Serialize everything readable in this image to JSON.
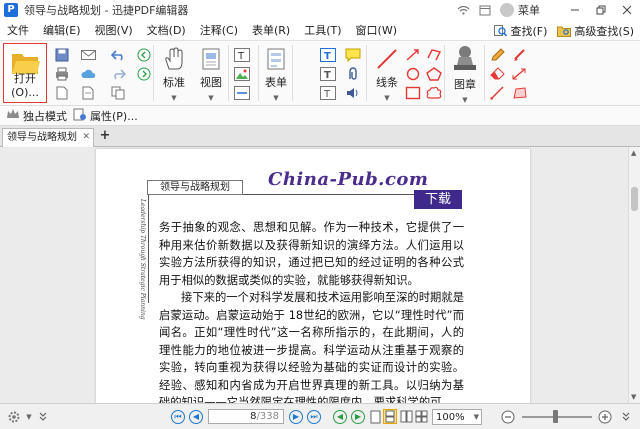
{
  "app": {
    "title": "领导与战略规划 - 迅捷PDF编辑器",
    "logo_letter": "P",
    "user_name": "菜单",
    "colors": {
      "accent": "#1e6fd9",
      "highlight_border": "#e53935",
      "brand_purple": "#4a2c8f"
    }
  },
  "menu": {
    "items": [
      "文件",
      "编辑(E)",
      "视图(V)",
      "文档(D)",
      "注释(C)",
      "表单(R)",
      "工具(T)",
      "窗口(W)"
    ],
    "search_label": "查找(F)",
    "advanced_search_label": "高级查找(S)"
  },
  "ribbon": {
    "open_label": "打开(O)...",
    "standard_label": "标准",
    "view_label": "视图",
    "form_label": "表单",
    "line_label": "线条",
    "stamp_label": "图章"
  },
  "modebar": {
    "exclusive_mode_label": "独占模式",
    "properties_label": "属性(P)..."
  },
  "tabs": [
    {
      "label": "领导与战略规划"
    }
  ],
  "document": {
    "header_box": "领导与战略规划",
    "brand": "China-Pub.com",
    "download_badge": "下载",
    "vertical_text": "Leadership Through Strategic Planning",
    "paragraphs": [
      "务于抽象的观念、思想和见解。作为一种技术，它提供了一种用来估价新数据以及获得新知识的演绎方法。人们运用以实验方法所获得的知识，通过把已知的经过证明的各种公式用于相似的数据或类似的实验，就能够获得新知识。",
      "接下来的一个对科学发展和技术运用影响至深的时期就是启蒙运动。启蒙运动始于 18世纪的欧洲，它以“理性时代”而闻名。正如“理性时代”这一名称所指示的，在此期间，人的理性能力的地位被进一步提高。科学运动从注重基于观察的实验，转向重视为获得以经验为基础的实证而设计的实验。经验、感知和内省成为开启世界真理的新工具。以归纳为基础的知识——它当然限定在理性的限度内，要求科学的可"
    ]
  },
  "status": {
    "current_page": "8",
    "total_pages": "/338",
    "zoom": "100%"
  }
}
